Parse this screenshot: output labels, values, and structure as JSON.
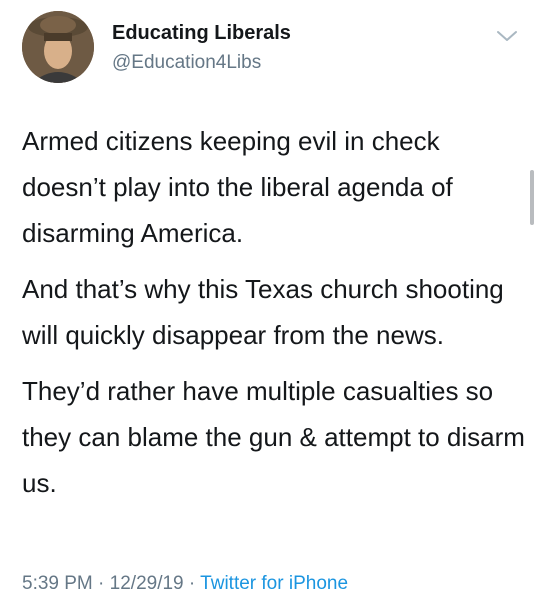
{
  "author": {
    "display_name": "Educating Liberals",
    "handle": "@Education4Libs"
  },
  "icons": {
    "avatar": "profile-photo",
    "menu": "chevron-down-icon"
  },
  "tweet": {
    "paragraphs": [
      "Armed citizens keeping evil in check doesn’t play into the liberal agenda of disarming America.",
      "And that’s why this Texas church shooting will quickly disappear from the news.",
      "They’d rather have multiple casualties so they can blame the gun & attempt to disarm us."
    ]
  },
  "meta": {
    "time": "5:39 PM",
    "separator": "·",
    "date": "12/29/19",
    "source": "Twitter for iPhone"
  },
  "colors": {
    "text": "#14171a",
    "secondary": "#657786",
    "link": "#1b95e0"
  }
}
